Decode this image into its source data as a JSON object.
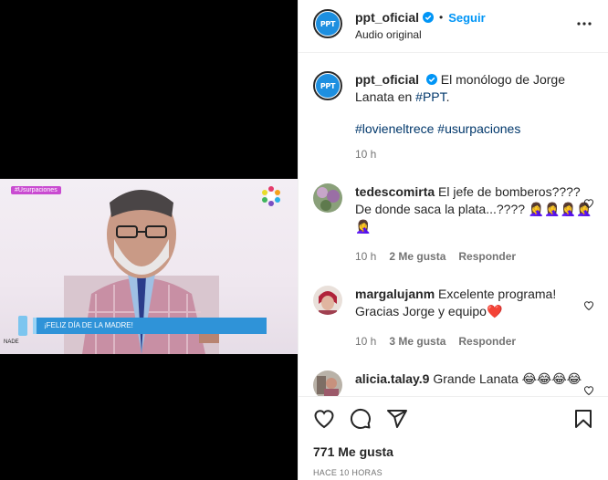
{
  "header": {
    "username": "ppt_oficial",
    "separator": "•",
    "follow_label": "Seguir",
    "audio": "Audio original",
    "avatar_text": "PPT"
  },
  "video": {
    "tag": "#Usurpaciones",
    "lower_third": "¡FELIZ DÍA DE LA MADRE!",
    "watermark": "NADE"
  },
  "caption": {
    "username": "ppt_oficial",
    "text": "El monólogo de Jorge Lanata en ",
    "hashtag_inline": "#PPT",
    "period": ".",
    "hashtag1": "#lovieneltrece",
    "hashtag2": "#usurpaciones",
    "time": "10 h"
  },
  "comments": [
    {
      "username": "tedescomirta",
      "text": "El jefe de bomberos???? De donde saca la plata...???? 🤦‍♀️🤦‍♀️🤦‍♀️🤦‍♀️🤦‍♀️",
      "time": "10 h",
      "likes": "2 Me gusta",
      "reply": "Responder"
    },
    {
      "username": "margalujanm",
      "text": "Excelente programa! Gracias Jorge y equipo❤️",
      "time": "10 h",
      "likes": "3 Me gusta",
      "reply": "Responder"
    },
    {
      "username": "alicia.talay.9",
      "text": "Grande Lanata 😂😂😂😂",
      "time": "",
      "likes": "",
      "reply": ""
    }
  ],
  "actions": {
    "likes": "771 Me gusta",
    "posted": "HACE 10 HORAS"
  },
  "icons": [
    "like-icon",
    "comment-icon",
    "share-icon",
    "save-icon",
    "more-icon",
    "verified-icon"
  ]
}
